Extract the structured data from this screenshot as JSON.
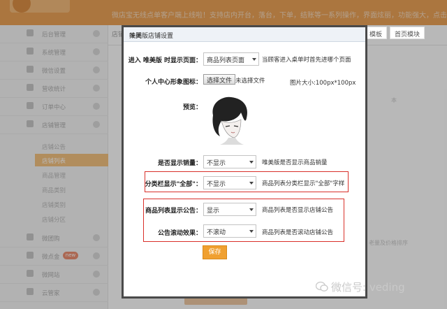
{
  "topbar": {
    "notice": "微店宝无线点单客户端上线啦！支持店内开台，落台，下单，结账等一系列操作，界面炫丽，功能强大，点击使用"
  },
  "sidebar": {
    "menus": [
      {
        "label": "后台管理",
        "icon": "grid-icon"
      },
      {
        "label": "系统管理",
        "icon": "grid-icon"
      },
      {
        "label": "微信设置",
        "icon": "grid-icon"
      },
      {
        "label": "营收统计",
        "icon": "chart-icon"
      },
      {
        "label": "订单中心",
        "icon": "list-icon"
      },
      {
        "label": "店铺管理",
        "icon": "store-icon"
      }
    ],
    "submenu": [
      "店铺公告",
      "店铺列表",
      "商品管理",
      "商品类别",
      "店铺类别",
      "店铺分区"
    ],
    "active_sub": "店铺列表",
    "lower_menus": [
      {
        "label": "微团购",
        "icon": "grid-icon"
      },
      {
        "label": "微点金",
        "icon": "grid-icon"
      },
      {
        "label": "微网站",
        "icon": "grid-icon"
      },
      {
        "label": "云管家",
        "icon": "grid-icon"
      }
    ],
    "badge": "new"
  },
  "main": {
    "tab_left": "店铺",
    "tab_peek_1": "模板",
    "tab_peek_2": "首页模块",
    "bg_text_1": "本",
    "bg_text_2": "老量及价格排序"
  },
  "modal": {
    "title": "唯美版店铺设置",
    "close_label": "关闭",
    "rows": {
      "entry": {
        "label": "进入 唯美版 时显示页面：",
        "value": "商品列表页面",
        "hint": "当顾客进入桌单时首先进哪个页面"
      },
      "avatar": {
        "label": "个人中心形象图标：",
        "button": "选择文件",
        "status": "未选择文件",
        "size_hint": "图片大小:100px*100px"
      },
      "preview": {
        "label": "预览："
      },
      "sales": {
        "label": "是否显示销量：",
        "value": "不显示",
        "hint": "唯美版是否显示商品销量"
      },
      "category_all": {
        "label": "分类栏显示\"全部\"：",
        "value": "不显示",
        "hint": "商品列表分类栏显示\"全部\"字样"
      },
      "notice_show": {
        "label": "商品列表显示公告：",
        "value": "显示",
        "hint": "商品列表是否显示店铺公告"
      },
      "notice_scroll": {
        "label": "公告滚动效果：",
        "value": "不滚动",
        "hint": "商品列表是否滚动店铺公告"
      }
    },
    "save_label": "保存"
  },
  "watermark": {
    "text": "微信号: veding"
  }
}
